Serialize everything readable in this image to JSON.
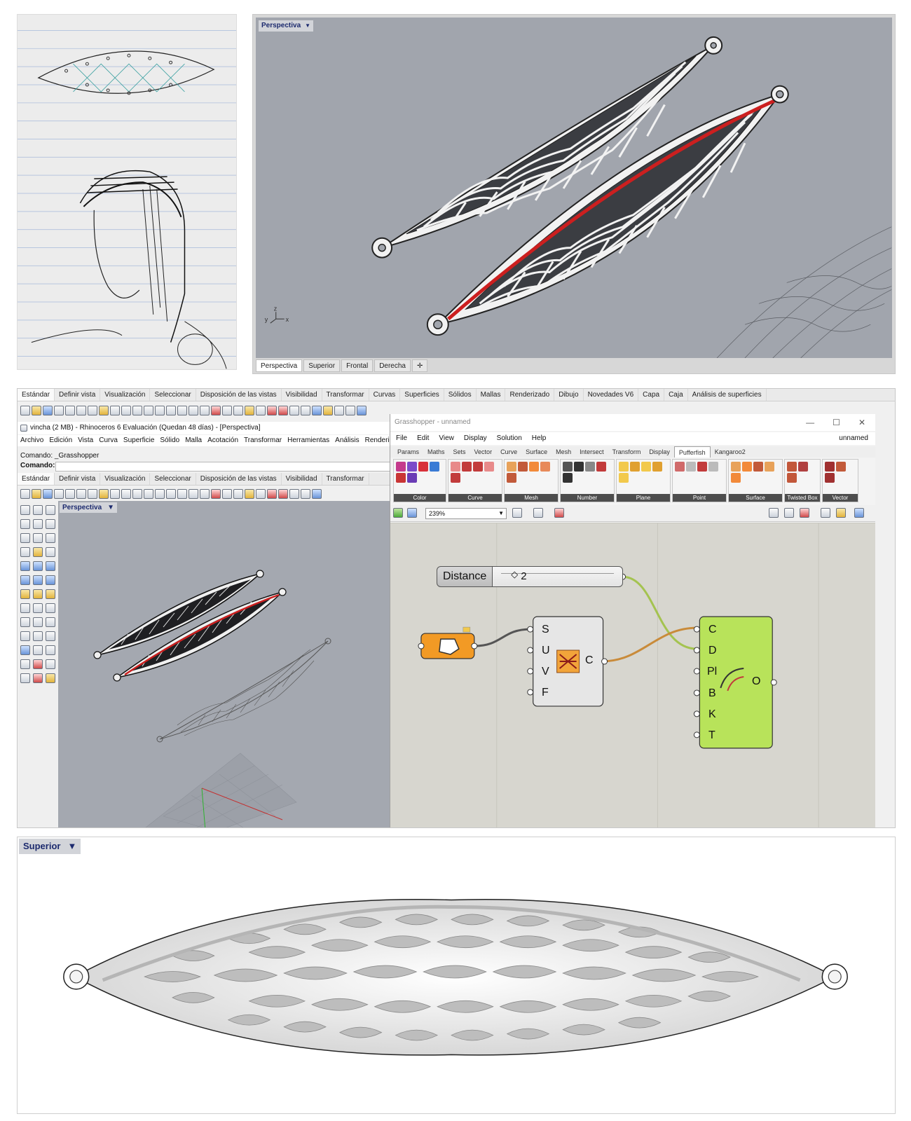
{
  "perspective_panel": {
    "viewport_title": "Perspectiva",
    "viewport_tabs": [
      "Perspectiva",
      "Superior",
      "Frontal",
      "Derecha"
    ],
    "axis_labels": [
      "y",
      "z",
      "x"
    ]
  },
  "rhino": {
    "toolbar_tabs": [
      "Estándar",
      "Definir vista",
      "Visualización",
      "Seleccionar",
      "Disposición de las vistas",
      "Visibilidad",
      "Transformar",
      "Curvas",
      "Superficies",
      "Sólidos",
      "Mallas",
      "Renderizado",
      "Dibujo",
      "Novedades V6",
      "Capa",
      "Caja",
      "Análisis de superficies"
    ],
    "toolbar_tabs_2": [
      "Estándar",
      "Definir vista",
      "Visualización",
      "Seleccionar",
      "Disposición de las vistas",
      "Visibilidad",
      "Transformar"
    ],
    "window_title": "vincha (2 MB) - Rhinoceros 6 Evaluación (Quedan 48 días) - [Perspectiva]",
    "menu": [
      "Archivo",
      "Edición",
      "Vista",
      "Curva",
      "Superficie",
      "Sólido",
      "Malla",
      "Acotación",
      "Transformar",
      "Herramientas",
      "Análisis",
      "Renderizad"
    ],
    "command_history": "Comando: _Grasshopper",
    "command_prompt": "Comando:",
    "viewport_title": "Perspectiva"
  },
  "grasshopper": {
    "window_title": "Grasshopper - unnamed",
    "window_controls": [
      "—",
      "☐",
      "✕"
    ],
    "menu": [
      "File",
      "Edit",
      "View",
      "Display",
      "Solution",
      "Help"
    ],
    "document_name": "unnamed",
    "tabs": [
      "Params",
      "Maths",
      "Sets",
      "Vector",
      "Curve",
      "Surface",
      "Mesh",
      "Intersect",
      "Transform",
      "Display",
      "Pufferfish",
      "Kangaroo2"
    ],
    "active_tab": "Pufferfish",
    "ribbon_groups": [
      "Color",
      "Curve",
      "Mesh",
      "Number",
      "Plane",
      "Point",
      "Surface",
      "Twisted Box",
      "Vector"
    ],
    "zoom": "239%",
    "slider": {
      "label": "Distance",
      "value": "2"
    },
    "component_1_inputs": [
      "S",
      "U",
      "V",
      "F"
    ],
    "component_1_output": "C",
    "component_2_inputs": [
      "C",
      "D",
      "Pl",
      "B",
      "K",
      "T"
    ],
    "component_2_output": "O"
  },
  "superior_panel": {
    "viewport_title": "Superior"
  },
  "colors": {
    "viewport_gray": "#a1a5ad",
    "rail_red": "#cc1f1f",
    "gh_green": "#b8e35a",
    "gh_orange": "#f29a25",
    "gh_canvas": "#d7d6cf"
  }
}
